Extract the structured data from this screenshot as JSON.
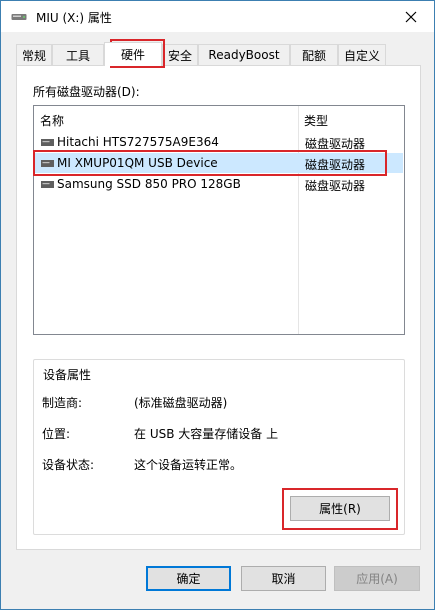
{
  "window": {
    "title": "MIU (X:) 属性",
    "close_icon": "close-icon"
  },
  "tabs": [
    {
      "label": "常规"
    },
    {
      "label": "工具"
    },
    {
      "label": "硬件"
    },
    {
      "label": "安全"
    },
    {
      "label": "ReadyBoost"
    },
    {
      "label": "配额"
    },
    {
      "label": "自定义"
    }
  ],
  "active_tab": "硬件",
  "hardware": {
    "list_label": "所有磁盘驱动器(D):",
    "columns": {
      "name": "名称",
      "type": "类型"
    },
    "devices": [
      {
        "name": "Hitachi HTS727575A9E364",
        "type": "磁盘驱动器"
      },
      {
        "name": "MI XMUP01QM USB Device",
        "type": "磁盘驱动器",
        "selected": true
      },
      {
        "name": "Samsung SSD 850 PRO 128GB",
        "type": "磁盘驱动器"
      }
    ],
    "properties": {
      "group_label": "设备属性",
      "manufacturer_label": "制造商:",
      "manufacturer_value": "(标准磁盘驱动器)",
      "location_label": "位置:",
      "location_value": "在 USB 大容量存储设备 上",
      "status_label": "设备状态:",
      "status_value": "这个设备运转正常。",
      "properties_button": "属性(R)"
    }
  },
  "footer": {
    "ok": "确定",
    "cancel": "取消",
    "apply": "应用(A)"
  },
  "colors": {
    "highlight": "#d9262a",
    "selection": "#cce8ff",
    "accent": "#0078d7"
  }
}
